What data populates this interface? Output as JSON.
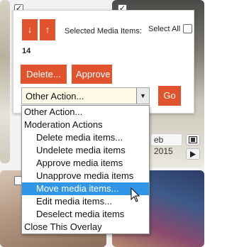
{
  "background": {
    "checkbox_marks": [
      "✓",
      "✓"
    ],
    "date_chip": "eb 2015",
    "film_icon": "film-icon",
    "play_icon": "play-icon"
  },
  "panel": {
    "move_down_label": "↓",
    "move_up_label": "↑",
    "selected_label": "Selected Media Items:",
    "select_all_label": "Select All",
    "selected_count": "14",
    "delete_label": "Delete...",
    "approve_label": "Approve",
    "action_select_value": "Other Action...",
    "go_label": "Go"
  },
  "dropdown": {
    "options": [
      {
        "label": "Other Action...",
        "level": 0
      },
      {
        "label": "Moderation Actions",
        "level": 0
      },
      {
        "label": "Delete media items...",
        "level": 1
      },
      {
        "label": "Undelete media items",
        "level": 1
      },
      {
        "label": "Approve media items",
        "level": 1
      },
      {
        "label": "Unapprove media items",
        "level": 1
      },
      {
        "label": "Move media items...",
        "level": 1,
        "highlighted": true
      },
      {
        "label": "Edit media items...",
        "level": 1
      },
      {
        "label": "Deselect media items",
        "level": 1
      },
      {
        "label": "Close This Overlay",
        "level": 0
      }
    ]
  },
  "colors": {
    "accent": "#e0532d",
    "highlight": "#3296e6",
    "select_bg": "#fffbe6"
  }
}
